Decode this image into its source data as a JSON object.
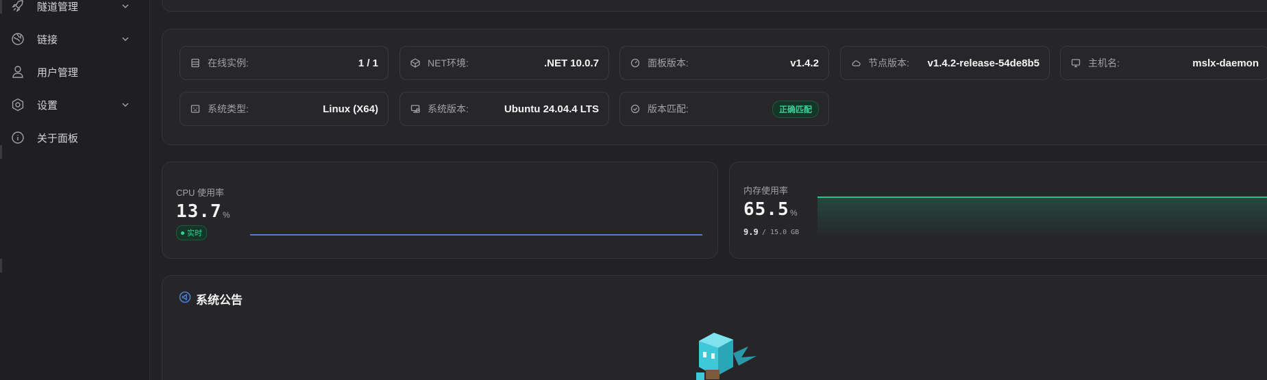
{
  "sidebar": {
    "items": [
      {
        "label": "隧道管理",
        "icon": "rocket-icon",
        "has_children": true
      },
      {
        "label": "链接",
        "icon": "link-globe-icon",
        "has_children": true
      },
      {
        "label": "用户管理",
        "icon": "user-icon",
        "has_children": false
      },
      {
        "label": "设置",
        "icon": "gear-icon",
        "has_children": true
      },
      {
        "label": "关于面板",
        "icon": "info-icon",
        "has_children": false
      }
    ]
  },
  "info": {
    "online_instances": {
      "label": "在线实例:",
      "value": "1 / 1",
      "icon": "server-icon"
    },
    "net_env": {
      "label": "NET环境:",
      "value": ".NET 10.0.7",
      "icon": "code-box-icon"
    },
    "panel_version": {
      "label": "面板版本:",
      "value": "v1.4.2",
      "icon": "gauge-icon"
    },
    "node_version": {
      "label": "节点版本:",
      "value": "v1.4.2-release-54de8b5",
      "icon": "cloud-icon"
    },
    "hostname": {
      "label": "主机名:",
      "value": "mslx-daemon",
      "icon": "monitor-icon"
    },
    "os_type": {
      "label": "系统类型:",
      "value": "Linux (X64)",
      "icon": "terminal-icon"
    },
    "os_version": {
      "label": "系统版本:",
      "value": "Ubuntu 24.04.4 LTS",
      "icon": "desktop-icon"
    },
    "version_match": {
      "label": "版本匹配:",
      "value": "正确匹配",
      "icon": "check-circle-icon"
    }
  },
  "cpu": {
    "label": "CPU 使用率",
    "value": "13.7",
    "unit": "%",
    "badge": "实时",
    "line_color": "#4a7fd6"
  },
  "memory": {
    "label": "内存使用率",
    "value": "65.5",
    "unit": "%",
    "used": "9.9",
    "total": "/ 15.0 GB",
    "line_color": "#22c58b"
  },
  "notice": {
    "title": "系统公告",
    "icon": "megaphone-icon"
  },
  "colors": {
    "accent_blue": "#4a7fd6",
    "accent_green": "#34d399",
    "background": "#222225",
    "card": "#262629"
  }
}
